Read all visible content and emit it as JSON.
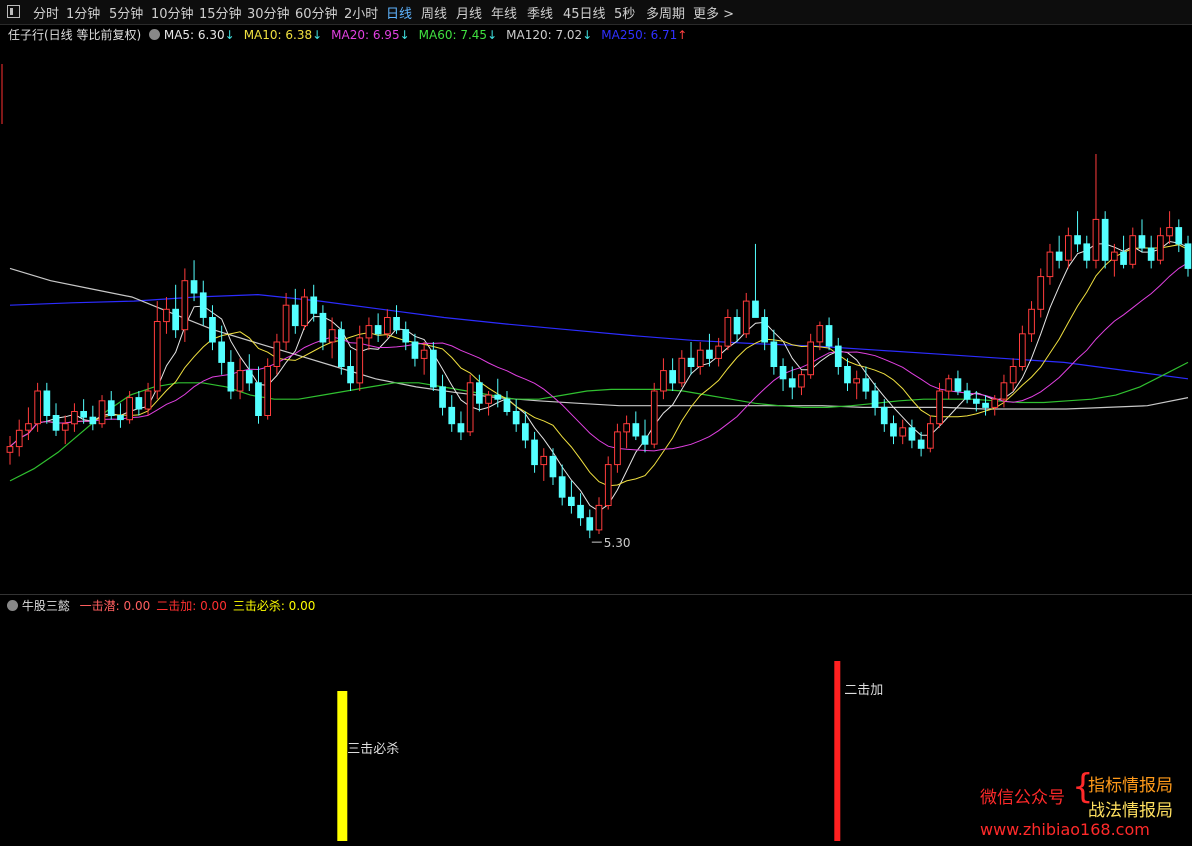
{
  "toolbar": {
    "tabs": [
      "分时",
      "1分钟",
      "5分钟",
      "10分钟",
      "15分钟",
      "30分钟",
      "60分钟",
      "2小时",
      "日线",
      "周线",
      "月线",
      "年线",
      "季线",
      "45日线",
      "5秒",
      "多周期",
      "更多 >"
    ],
    "active_index": 8
  },
  "price_legend": {
    "stock_name": "任子行(日线 等比前复权)",
    "items": [
      {
        "label": "MA5: 6.30",
        "arrow": "↓",
        "color": "#e6e6e6"
      },
      {
        "label": "MA10: 6.38",
        "arrow": "↓",
        "color": "#f0e040"
      },
      {
        "label": "MA20: 6.95",
        "arrow": "↓",
        "color": "#e040e0"
      },
      {
        "label": "MA60: 7.45",
        "arrow": "↓",
        "color": "#40e040"
      },
      {
        "label": "MA120: 7.02",
        "arrow": "↓",
        "color": "#cccccc"
      },
      {
        "label": "MA250: 6.71",
        "arrow": "↑",
        "color": "#3030ff"
      }
    ]
  },
  "indicator_legend": {
    "name": "牛股三懿",
    "items": [
      {
        "label": "一击潜: 0.00",
        "color": "#ff6060"
      },
      {
        "label": "二击加: 0.00",
        "color": "#ff3030"
      },
      {
        "label": "三击必杀: 0.00",
        "color": "#ffff00"
      }
    ]
  },
  "chart_data": {
    "type": "candlestick",
    "ylim": [
      4.8,
      10.0
    ],
    "low_annotation": "5.30",
    "ohlc": [
      [
        6.35,
        6.55,
        6.2,
        6.42
      ],
      [
        6.42,
        6.75,
        6.3,
        6.62
      ],
      [
        6.62,
        6.9,
        6.5,
        6.7
      ],
      [
        6.7,
        7.2,
        6.6,
        7.1
      ],
      [
        7.1,
        7.2,
        6.7,
        6.8
      ],
      [
        6.8,
        6.95,
        6.55,
        6.62
      ],
      [
        6.62,
        6.8,
        6.45,
        6.7
      ],
      [
        6.7,
        6.95,
        6.6,
        6.85
      ],
      [
        6.85,
        7.0,
        6.7,
        6.78
      ],
      [
        6.78,
        6.92,
        6.62,
        6.7
      ],
      [
        6.7,
        7.05,
        6.65,
        6.98
      ],
      [
        6.98,
        7.1,
        6.75,
        6.8
      ],
      [
        6.8,
        6.95,
        6.65,
        6.75
      ],
      [
        6.75,
        7.1,
        6.7,
        7.02
      ],
      [
        7.02,
        7.1,
        6.8,
        6.88
      ],
      [
        6.88,
        7.2,
        6.8,
        7.1
      ],
      [
        7.1,
        8.2,
        7.0,
        7.95
      ],
      [
        7.95,
        8.25,
        7.8,
        8.1
      ],
      [
        8.1,
        8.4,
        7.75,
        7.85
      ],
      [
        7.85,
        8.6,
        7.7,
        8.45
      ],
      [
        8.45,
        8.7,
        8.2,
        8.3
      ],
      [
        8.3,
        8.45,
        7.9,
        8.0
      ],
      [
        8.0,
        8.15,
        7.6,
        7.7
      ],
      [
        7.7,
        7.9,
        7.3,
        7.45
      ],
      [
        7.45,
        7.6,
        7.0,
        7.1
      ],
      [
        7.1,
        7.5,
        7.0,
        7.35
      ],
      [
        7.35,
        7.55,
        7.1,
        7.2
      ],
      [
        7.2,
        7.4,
        6.7,
        6.8
      ],
      [
        6.8,
        7.5,
        6.75,
        7.4
      ],
      [
        7.4,
        7.8,
        7.3,
        7.7
      ],
      [
        7.7,
        8.3,
        7.6,
        8.15
      ],
      [
        8.15,
        8.35,
        7.8,
        7.9
      ],
      [
        7.9,
        8.35,
        7.85,
        8.25
      ],
      [
        8.25,
        8.4,
        7.95,
        8.05
      ],
      [
        8.05,
        8.15,
        7.6,
        7.7
      ],
      [
        7.7,
        8.0,
        7.5,
        7.85
      ],
      [
        7.85,
        7.95,
        7.3,
        7.4
      ],
      [
        7.4,
        7.6,
        7.1,
        7.2
      ],
      [
        7.2,
        7.9,
        7.1,
        7.75
      ],
      [
        7.75,
        8.0,
        7.6,
        7.9
      ],
      [
        7.9,
        8.05,
        7.7,
        7.8
      ],
      [
        7.8,
        8.1,
        7.75,
        8.0
      ],
      [
        8.0,
        8.15,
        7.8,
        7.85
      ],
      [
        7.85,
        7.95,
        7.6,
        7.7
      ],
      [
        7.7,
        7.8,
        7.4,
        7.5
      ],
      [
        7.5,
        7.7,
        7.3,
        7.6
      ],
      [
        7.6,
        7.7,
        7.1,
        7.15
      ],
      [
        7.15,
        7.3,
        6.8,
        6.9
      ],
      [
        6.9,
        7.05,
        6.6,
        6.7
      ],
      [
        6.7,
        6.85,
        6.5,
        6.6
      ],
      [
        6.6,
        7.3,
        6.55,
        7.2
      ],
      [
        7.2,
        7.3,
        6.85,
        6.95
      ],
      [
        6.95,
        7.1,
        6.8,
        7.05
      ],
      [
        7.05,
        7.25,
        6.9,
        7.0
      ],
      [
        7.0,
        7.1,
        6.8,
        6.85
      ],
      [
        6.85,
        7.0,
        6.6,
        6.7
      ],
      [
        6.7,
        6.85,
        6.4,
        6.5
      ],
      [
        6.5,
        6.6,
        6.1,
        6.2
      ],
      [
        6.2,
        6.4,
        6.0,
        6.3
      ],
      [
        6.3,
        6.4,
        5.95,
        6.05
      ],
      [
        6.05,
        6.2,
        5.7,
        5.8
      ],
      [
        5.8,
        6.0,
        5.6,
        5.7
      ],
      [
        5.7,
        5.85,
        5.45,
        5.55
      ],
      [
        5.55,
        5.65,
        5.3,
        5.4
      ],
      [
        5.4,
        5.8,
        5.35,
        5.7
      ],
      [
        5.7,
        6.3,
        5.65,
        6.2
      ],
      [
        6.2,
        6.7,
        6.1,
        6.6
      ],
      [
        6.6,
        6.8,
        6.4,
        6.7
      ],
      [
        6.7,
        6.85,
        6.5,
        6.55
      ],
      [
        6.55,
        6.75,
        6.35,
        6.45
      ],
      [
        6.45,
        7.2,
        6.4,
        7.1
      ],
      [
        7.1,
        7.5,
        7.0,
        7.35
      ],
      [
        7.35,
        7.5,
        7.1,
        7.2
      ],
      [
        7.2,
        7.6,
        7.15,
        7.5
      ],
      [
        7.5,
        7.7,
        7.3,
        7.4
      ],
      [
        7.4,
        7.7,
        7.3,
        7.6
      ],
      [
        7.6,
        7.8,
        7.4,
        7.5
      ],
      [
        7.5,
        7.75,
        7.4,
        7.65
      ],
      [
        7.65,
        8.1,
        7.6,
        8.0
      ],
      [
        8.0,
        8.1,
        7.7,
        7.8
      ],
      [
        7.8,
        8.3,
        7.75,
        8.2
      ],
      [
        8.2,
        8.9,
        8.1,
        8.0
      ],
      [
        8.0,
        8.1,
        7.6,
        7.7
      ],
      [
        7.7,
        7.85,
        7.3,
        7.4
      ],
      [
        7.4,
        7.5,
        7.1,
        7.25
      ],
      [
        7.25,
        7.4,
        7.0,
        7.15
      ],
      [
        7.15,
        7.35,
        7.05,
        7.3
      ],
      [
        7.3,
        7.8,
        7.25,
        7.7
      ],
      [
        7.7,
        7.95,
        7.6,
        7.9
      ],
      [
        7.9,
        8.0,
        7.6,
        7.65
      ],
      [
        7.65,
        7.75,
        7.3,
        7.4
      ],
      [
        7.4,
        7.5,
        7.1,
        7.2
      ],
      [
        7.2,
        7.35,
        7.0,
        7.25
      ],
      [
        7.25,
        7.4,
        7.0,
        7.1
      ],
      [
        7.1,
        7.2,
        6.8,
        6.9
      ],
      [
        6.9,
        7.0,
        6.6,
        6.7
      ],
      [
        6.7,
        6.8,
        6.45,
        6.55
      ],
      [
        6.55,
        6.75,
        6.45,
        6.65
      ],
      [
        6.65,
        6.75,
        6.4,
        6.5
      ],
      [
        6.5,
        6.6,
        6.3,
        6.4
      ],
      [
        6.4,
        6.8,
        6.35,
        6.7
      ],
      [
        6.7,
        7.2,
        6.65,
        7.1
      ],
      [
        7.1,
        7.3,
        7.0,
        7.25
      ],
      [
        7.25,
        7.35,
        7.05,
        7.1
      ],
      [
        7.1,
        7.2,
        6.95,
        7.0
      ],
      [
        7.0,
        7.1,
        6.85,
        6.95
      ],
      [
        6.95,
        7.05,
        6.8,
        6.9
      ],
      [
        6.9,
        7.05,
        6.8,
        7.0
      ],
      [
        7.0,
        7.3,
        6.9,
        7.2
      ],
      [
        7.2,
        7.5,
        7.1,
        7.4
      ],
      [
        7.4,
        7.9,
        7.35,
        7.8
      ],
      [
        7.8,
        8.2,
        7.7,
        8.1
      ],
      [
        8.1,
        8.6,
        8.0,
        8.5
      ],
      [
        8.5,
        8.9,
        8.4,
        8.8
      ],
      [
        8.8,
        9.0,
        8.6,
        8.7
      ],
      [
        8.7,
        9.1,
        8.6,
        9.0
      ],
      [
        9.0,
        9.3,
        8.8,
        8.9
      ],
      [
        8.9,
        9.0,
        8.6,
        8.7
      ],
      [
        8.7,
        10.0,
        8.6,
        9.2
      ],
      [
        9.2,
        9.3,
        8.6,
        8.7
      ],
      [
        8.7,
        8.9,
        8.5,
        8.8
      ],
      [
        8.8,
        9.0,
        8.6,
        8.65
      ],
      [
        8.65,
        9.1,
        8.6,
        9.0
      ],
      [
        9.0,
        9.2,
        8.8,
        8.85
      ],
      [
        8.85,
        9.0,
        8.6,
        8.7
      ],
      [
        8.7,
        9.1,
        8.65,
        9.0
      ],
      [
        9.0,
        9.3,
        8.9,
        9.1
      ],
      [
        9.1,
        9.2,
        8.8,
        8.9
      ],
      [
        8.9,
        9.0,
        8.5,
        8.6
      ]
    ],
    "ma_lines": [
      {
        "name": "MA5",
        "color": "#e6e6e6",
        "period": 5
      },
      {
        "name": "MA10",
        "color": "#f0e040",
        "period": 10
      },
      {
        "name": "MA20",
        "color": "#e040e0",
        "period": 20
      }
    ],
    "ma60": [
      6.0,
      6.15,
      6.35,
      6.6,
      6.85,
      7.05,
      7.15,
      7.2,
      7.2,
      7.15,
      7.05,
      7.0,
      7.0,
      7.05,
      7.1,
      7.15,
      7.2,
      7.2,
      7.15,
      7.1,
      7.05,
      7.0,
      7.0,
      7.05,
      7.1,
      7.12,
      7.12,
      7.12,
      7.1,
      7.05,
      7.0,
      6.95,
      6.92,
      6.9,
      6.9,
      6.92,
      6.95,
      6.98,
      7.0,
      7.0,
      7.0,
      6.98,
      6.96,
      6.96,
      6.98,
      7.0,
      7.05,
      7.15,
      7.3,
      7.45
    ],
    "ma120": [
      8.6,
      8.45,
      8.35,
      8.25,
      8.05,
      7.85,
      7.7,
      7.55,
      7.4,
      7.25,
      7.15,
      7.08,
      7.02,
      6.98,
      6.95,
      6.92,
      6.92,
      6.92,
      6.92,
      6.92,
      6.92,
      6.9,
      6.9,
      6.9,
      6.88,
      6.88,
      6.88,
      6.9,
      6.92,
      7.02
    ],
    "ma250": [
      8.15,
      8.18,
      8.2,
      8.25,
      8.28,
      8.2,
      8.1,
      8.0,
      7.92,
      7.85,
      7.78,
      7.72,
      7.68,
      7.65,
      7.6,
      7.55,
      7.5,
      7.45,
      7.35,
      7.25
    ]
  },
  "indicator_bars": [
    {
      "label": "三击必杀",
      "color": "#ffff00",
      "index": 36,
      "height": 1.0
    },
    {
      "label": "二击加",
      "color": "#ff2020",
      "index": 90,
      "height": 1.2
    }
  ],
  "watermark": {
    "left": "微信公众号",
    "right_top": "指标情报局",
    "right_bottom": "战法情报局",
    "url": "www.zhibiao168.com"
  }
}
